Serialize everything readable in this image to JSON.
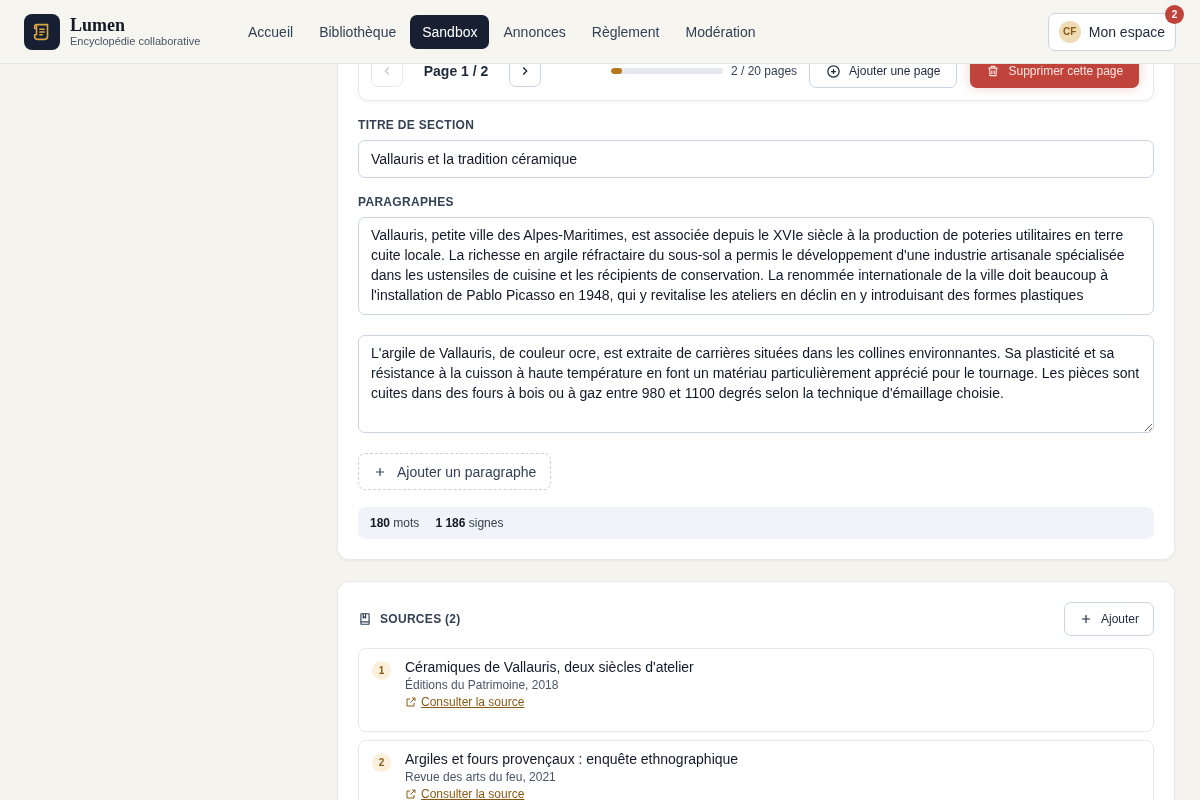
{
  "header": {
    "brand": "Lumen",
    "tagline": "Encyclopédie collaborative",
    "nav": [
      {
        "label": "Accueil",
        "selected": false
      },
      {
        "label": "Bibliothèque",
        "selected": false
      },
      {
        "label": "Sandbox",
        "selected": true
      },
      {
        "label": "Annonces",
        "selected": false
      },
      {
        "label": "Règlement",
        "selected": false
      },
      {
        "label": "Modération",
        "selected": false
      }
    ],
    "account": {
      "initials": "CF",
      "label": "Mon espace",
      "badge": "2"
    }
  },
  "pager": {
    "prev_disabled": true,
    "page": "Page 1 / 2",
    "next_disabled": false,
    "level": 0.1,
    "count": "2 / 20 pages",
    "add": "Ajouter une page",
    "delete": "Supprimer cette page"
  },
  "editor": {
    "title_label": "TITRE DE SECTION",
    "title_value": "Vallauris et la tradition céramique",
    "paragraphs_label": "PARAGRAPHES",
    "paragraphs": [
      {
        "value": "Vallauris, petite ville des Alpes-Maritimes, est associée depuis le XVIe siècle à la production de poteries utilitaires en terre cuite locale. La richesse en argile réfractaire du sous-sol a permis le développement d'une industrie artisanale spécialisée dans les ustensiles de cuisine et les récipients de conservation. La renommée internationale de la ville doit beaucoup à l'installation de Pablo Picasso en 1948, qui y revitalise les ateliers en déclin en y introduisant des formes plastiques"
      },
      {
        "value": "L'argile de Vallauris, de couleur ocre, est extraite de carrières situées dans les collines environnantes. Sa plasticité et sa résistance à la cuisson à haute température en font un matériau particulièrement apprécié pour le tournage. Les pièces sont cuites dans des fours à bois ou à gaz entre 980 et 1100 degrés selon la technique d'émaillage choisie."
      }
    ],
    "add_paragraph": "Ajouter un paragraphe",
    "stats": "**180** mots",
    "stats2": "**1 186** signes"
  },
  "sources": {
    "title": "SOURCES (2)",
    "add": "Ajouter",
    "items": [
      {
        "number": "1",
        "title": "Céramiques de Vallauris, deux siècles d'atelier",
        "meta": "Éditions du Patrimoine, 2018",
        "link": "Consulter la source"
      },
      {
        "number": "2",
        "title": "Argiles et fours provençaux : enquête ethnographique",
        "meta": "Revue des arts du feu, 2021",
        "link": "Consulter la source"
      }
    ]
  }
}
